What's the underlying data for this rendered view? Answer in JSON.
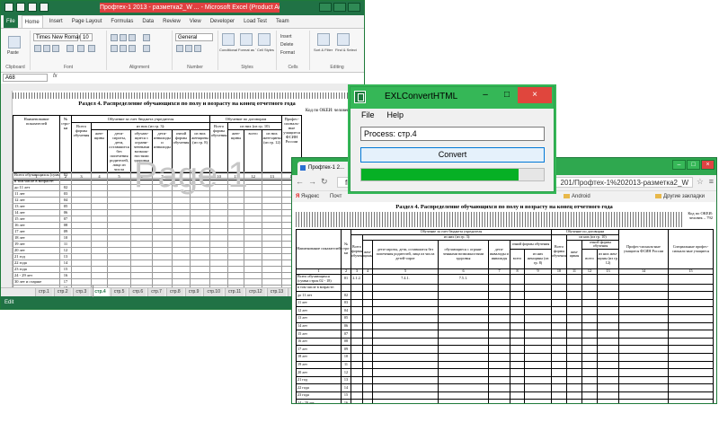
{
  "excel": {
    "title": "Профтех-1 2013 - разметка2_W ... - Microsoft Excel (Product Activation Failed)",
    "ribbon_tabs": [
      "File",
      "Home",
      "Insert",
      "Page Layout",
      "Formulas",
      "Data",
      "Review",
      "View",
      "Developer",
      "Load Test",
      "Team"
    ],
    "font_name": "Times New Roman",
    "font_size": "10",
    "groups": {
      "clipboard": "Clipboard",
      "font": "Font",
      "alignment": "Alignment",
      "number": "Number",
      "styles": "Styles",
      "cells": "Cells",
      "editing": "Editing"
    },
    "ribbon_buttons": {
      "paste": "Paste",
      "general": "General",
      "cond_format": "Conditional Formatting",
      "format_table": "Format as Table",
      "cell_styles": "Cell Styles",
      "insert": "Insert",
      "delete": "Delete",
      "format": "Format",
      "sort": "Sort & Filter",
      "find": "Find & Select"
    },
    "name_box": "A68",
    "fx": "fx",
    "sheet_title": "Раздел 4. Распределение обучающихся по полу и возрасту на конец отчетного года",
    "okud": "Код по ОКЕИ: человек – 792",
    "header": {
      "indicators": "Наименование показателей",
      "line_no": "№ стро-ки",
      "budget": "Обучение за счет бюджета учредителя",
      "budget_sub": "из них (из гр. 3):",
      "contract": "Обучение по договорам",
      "contract_sub": "из них (из гр. 10)",
      "prof": "Профес-сиональ-ные учащиеся ФСИН России",
      "total_forms": "Всего формы обучения",
      "women": "жен-щины",
      "orphans": "дети-сироты, дети, оставшиеся без попечения родителей, лица из числа",
      "disabled": "обучаю-щиеся с ограни-ченными возмож-ностями здоровья",
      "invalids": "дети-инвалиды и инвалиды",
      "fulltime": "очной формы обучения",
      "total": "всего",
      "of_women": "из них женщины (из гр. 8)",
      "total_forms2": "Всего формы обучения",
      "women2": "жен-щины",
      "of_women2": "из них жен-щины (из гр. 12)",
      "nums": [
        "1",
        "2",
        "3",
        "4",
        "5",
        "6",
        "7",
        "8",
        "9",
        "10",
        "11",
        "12",
        "13",
        "14"
      ]
    },
    "rows": [
      {
        "label": "Всего обучающихся (сумма строк 02 - 18)",
        "no": "01"
      },
      {
        "label": "в том числе в возрасте:",
        "no": ""
      },
      {
        "label": "до 11 лет",
        "no": "02"
      },
      {
        "label": "11 лет",
        "no": "03"
      },
      {
        "label": "12 лет",
        "no": "04"
      },
      {
        "label": "13 лет",
        "no": "05"
      },
      {
        "label": "14 лет",
        "no": "06"
      },
      {
        "label": "15 лет",
        "no": "07"
      },
      {
        "label": "16 лет",
        "no": "08"
      },
      {
        "label": "17 лет",
        "no": "09"
      },
      {
        "label": "18 лет",
        "no": "10"
      },
      {
        "label": "19 лет",
        "no": "11"
      },
      {
        "label": "20 лет",
        "no": "12"
      },
      {
        "label": "21 год",
        "no": "13"
      },
      {
        "label": "22 года",
        "no": "14"
      },
      {
        "label": "23 года",
        "no": "15"
      },
      {
        "label": "24 - 29 лет",
        "no": "16"
      },
      {
        "label": "30 лет и старше",
        "no": "17"
      },
      {
        "label": "возраст неизвестен",
        "no": "18"
      }
    ],
    "watermark": "Page 1",
    "sheet_tabs": [
      "стр.1",
      "стр.2",
      "стр.3",
      "стр.4",
      "стр.5",
      "стр.6",
      "стр.7",
      "стр.8",
      "стр.9",
      "стр.10",
      "стр.11",
      "стр.12",
      "стр.13",
      "стр.14",
      "стр.15"
    ],
    "active_sheet": "стр.4",
    "status": "Edit"
  },
  "chrome": {
    "tab_title": "Профтех-1 2...",
    "tab_close": "×",
    "url_start": "fi",
    "url_visible": "201/Профтех-1%202013-разметка2_W",
    "bookmarks": [
      {
        "label": "Яндекс"
      },
      {
        "label": "Почт"
      },
      {
        "label": "Android"
      },
      {
        "label": "Другие закладки"
      }
    ],
    "table_title": "Раздел 4. Распределение обучающихся по полу и возрасту на конец отчетного года",
    "okud": "Код по ОКЕИ: человек – 792",
    "header": {
      "indicators": "Наименование показателей",
      "line_no": "№ стро-ки",
      "budget": "Обучение за счет бюджета учредителя",
      "budget_sub": "из них (из гр. 3):",
      "contract": "Обучение по договорам",
      "contract_sub": "из них (из гр. 10)",
      "total_forms": "Всего формы обучения",
      "women": "жен-щины",
      "orphans": "дети-сироты, дети, оставшиеся без попечения родителей, лица из числа детей-сирот",
      "disabled": "обучающиеся с ограни-ченными возможностями здоровья",
      "invalids": "дети-инвалиды и инвалиды",
      "fulltime": "очной формы обучения",
      "total": "всего",
      "of_women": "из них женщины (из гр. 8)",
      "total_forms2": "Всего формы обучения",
      "women2": "жен-щины",
      "of_women2": "из них жен-щины (из гр. 12)",
      "prof": "Профес-сиональ-ные учащиеся ФСИН России",
      "special": "Специальные профес-сиональ-ные учащиеся",
      "nums": [
        "1",
        "2",
        "3",
        "4",
        "5",
        "6",
        "7",
        "8",
        "9",
        "10",
        "11",
        "12",
        "13",
        "14",
        "15"
      ]
    },
    "row1_values": {
      "c3": "2.1.2.",
      "c5": "7.4.1.",
      "c6": "7.5.1."
    }
  },
  "dialog": {
    "title": "EXLConvertHTML",
    "menu": [
      "File",
      "Help"
    ],
    "process": "Process: стр.4",
    "convert": "Convert",
    "progress": 0.86
  }
}
